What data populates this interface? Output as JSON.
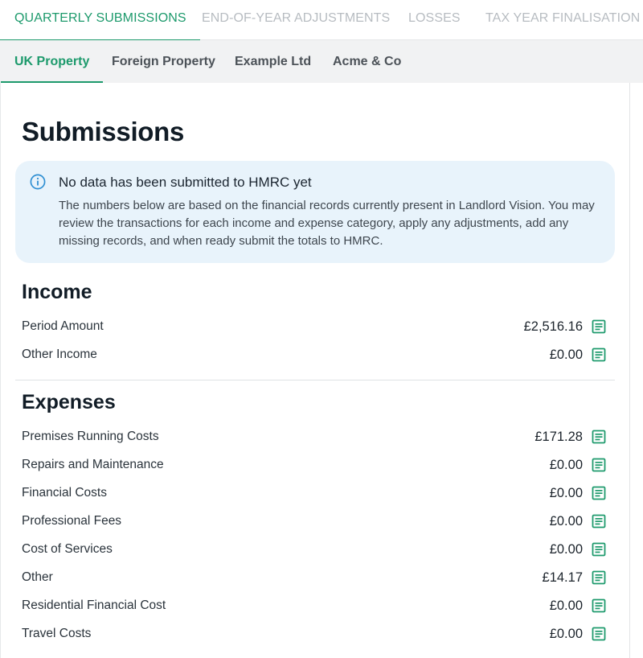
{
  "top_tabs": [
    {
      "label": "QUARTERLY SUBMISSIONS",
      "active": true
    },
    {
      "label": "END-OF-YEAR ADJUSTMENTS",
      "active": false
    },
    {
      "label": "LOSSES",
      "active": false
    },
    {
      "label": "TAX YEAR FINALISATION",
      "active": false
    }
  ],
  "sub_tabs": [
    {
      "label": "UK Property",
      "active": true
    },
    {
      "label": "Foreign Property",
      "active": false
    },
    {
      "label": "Example Ltd",
      "active": false
    },
    {
      "label": "Acme & Co",
      "active": false
    }
  ],
  "page_title": "Submissions",
  "info": {
    "icon": "info-icon",
    "title": "No data has been submitted to HMRC yet",
    "body": "The numbers below are based on the financial records currently present in Landlord Vision. You may review the transactions for each income and expense category, apply any adjustments, add any missing records, and when ready submit the totals to HMRC."
  },
  "income": {
    "title": "Income",
    "rows": [
      {
        "label": "Period Amount",
        "amount": "£2,516.16"
      },
      {
        "label": "Other Income",
        "amount": "£0.00"
      }
    ]
  },
  "expenses": {
    "title": "Expenses",
    "rows": [
      {
        "label": "Premises Running Costs",
        "amount": "£171.28"
      },
      {
        "label": "Repairs and Maintenance",
        "amount": "£0.00"
      },
      {
        "label": "Financial Costs",
        "amount": "£0.00"
      },
      {
        "label": "Professional Fees",
        "amount": "£0.00"
      },
      {
        "label": "Cost of Services",
        "amount": "£0.00"
      },
      {
        "label": "Other",
        "amount": "£14.17"
      },
      {
        "label": "Residential Financial Cost",
        "amount": "£0.00"
      },
      {
        "label": "Travel Costs",
        "amount": "£0.00"
      }
    ]
  },
  "row_icon": "document-list-icon",
  "colors": {
    "accent": "#1d9a6c",
    "info_bg": "#e8f3fb",
    "info_icon": "#2f8fd3",
    "inactive_tab": "#b7bcc1"
  }
}
